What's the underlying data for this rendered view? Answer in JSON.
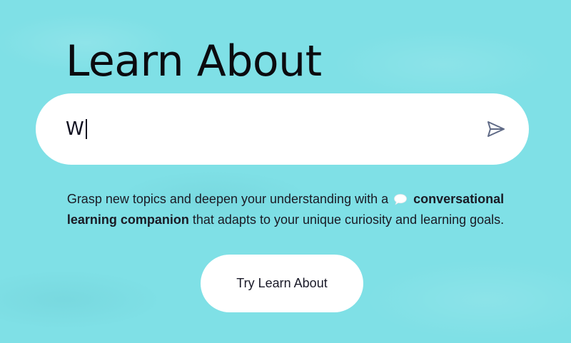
{
  "page": {
    "title": "Learn About"
  },
  "search": {
    "value": "W"
  },
  "description": {
    "part1": "Grasp new topics and deepen your understanding with a",
    "bold1": "conversational",
    "bold2": "learning companion",
    "part2": "that adapts to your unique curiosity and learning goals."
  },
  "cta": {
    "label": "Try Learn About"
  },
  "colors": {
    "background": "#7fe0e6",
    "surface": "#ffffff",
    "text": "#0b0b0f",
    "send_icon": "#5f6a86"
  },
  "icons": {
    "send": "send-icon",
    "chat": "chat-bubble-icon"
  }
}
